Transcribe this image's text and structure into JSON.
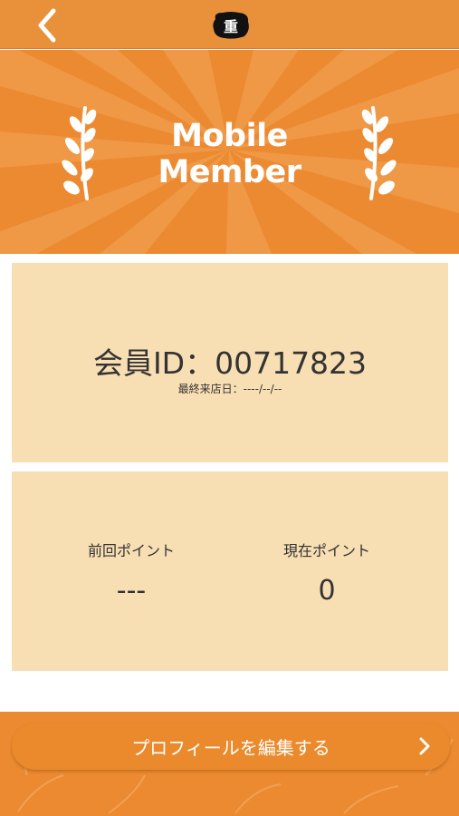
{
  "header": {
    "logo_text": "重",
    "icons": {
      "back": "chevron-left-icon",
      "logo": "brand-logo"
    }
  },
  "hero": {
    "title_line1": "Mobile",
    "title_line2": "Member",
    "icons": {
      "left": "laurel-left-icon",
      "right": "laurel-right-icon"
    }
  },
  "member": {
    "id_label": "会員ID：00717823",
    "last_visit": "最終来店日：----/--/--"
  },
  "points": {
    "previous_label": "前回ポイント",
    "previous_value": "---",
    "current_label": "現在ポイント",
    "current_value": "0"
  },
  "footer": {
    "edit_profile_label": "プロフィールを編集する",
    "icons": {
      "arrow": "chevron-right-icon"
    }
  },
  "colors": {
    "header_bg": "#e9913a",
    "hero_bg": "#ec8a31",
    "panel_bg": "#f8deb3",
    "text": "#333333"
  }
}
